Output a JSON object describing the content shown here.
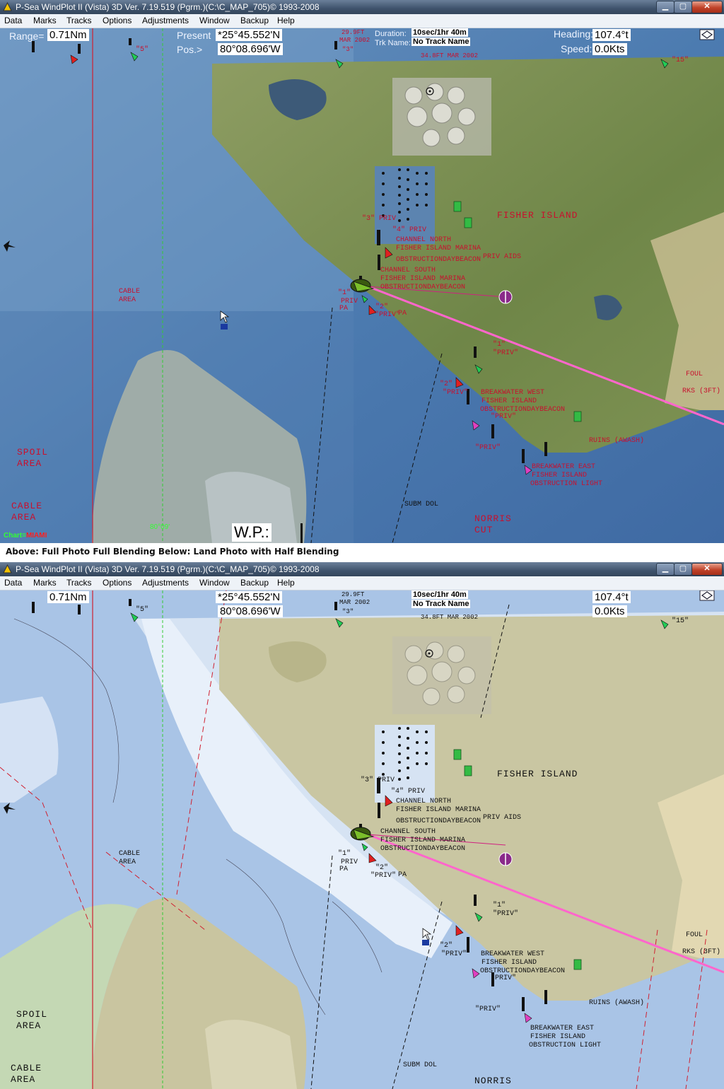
{
  "app": {
    "title": "P-Sea WindPlot II (Vista)  3D Ver. 7.19.519 (Pgrm.)(C:\\C_MAP_705)© 1993-2008",
    "min_glyph": "▁",
    "max_glyph": "▢",
    "close_glyph": "✕"
  },
  "menu": [
    "Data",
    "Marks",
    "Tracks",
    "Options",
    "Adjustments",
    "Window",
    "Backup",
    "Help"
  ],
  "hud": {
    "range_label": "Range=",
    "range_value": "0.71Nm",
    "present_label": "Present",
    "pos_label": "Pos.>",
    "lat": "*25°45.552'N",
    "lon": "80°08.696'W",
    "duration_label": "Duration:",
    "duration_value": "10sec/1hr 40m",
    "track_label": "Trk Name:",
    "track_value": "No Track Name",
    "heading_label": "Heading:",
    "heading_value": "107.4°t",
    "speed_label": "Speed:",
    "speed_value": "0.0Kts",
    "wp_label": "W.P.:",
    "chart_prefix": "Chart=",
    "chart_name": "MIAMI",
    "longitude_tick": "80°09'"
  },
  "caption": "Above: Full Photo Full Blending  Below: Land Photo with Half Blending",
  "chart_labels": {
    "fisher_island": "FISHER ISLAND",
    "spoil": "SPOIL",
    "area": "AREA",
    "cable": "CABLE",
    "cable_area_small_1": "CABLE",
    "cable_area_small_2": "AREA",
    "norris": "NORRIS",
    "cut": "CUT",
    "foul": "FOUL",
    "rks": "RKS (3FT)",
    "ruins": "RUINS (AWASH)",
    "priv_aids": "PRIV AIDS",
    "channel_north": "CHANNEL NORTH",
    "fisher_island_marina": "FISHER ISLAND MARINA",
    "obstruction_daybeacon": "OBSTRUCTIONDAYBEACON",
    "channel_south": "CHANNEL SOUTH",
    "breakwater_west": "BREAKWATER WEST",
    "fisher_island_small": "FISHER ISLAND",
    "breakwater_east": "BREAKWATER EAST",
    "obstruction_light": "OBSTRUCTION LIGHT",
    "subm_dol": "SUBM DOL",
    "priv_3": "\"3\" PRIV",
    "priv_4": "\"4\" PRIV",
    "priv_1": "\"1\"",
    "priv": "\"PRIV\"",
    "priv_2": "\"2\"",
    "priv_word": "PRIV",
    "pa": "PA",
    "quote_5": "\"5\"",
    "quote_15": "\"15\"",
    "depth_top": "29.9FT",
    "mar_2002": "MAR 2002",
    "quote_3": "\"3\"",
    "depth_top2": "34.8FT MAR 2002"
  },
  "colors": {
    "chart_red": "#c8102e",
    "track_pink": "#ff66cc",
    "water_photo": "#4f7fb4",
    "land_photo": "#7a8d52",
    "water_chart": "#dfe9f5",
    "shallow_chart": "#a8c3e6",
    "land_chart": "#c9c8a4"
  }
}
